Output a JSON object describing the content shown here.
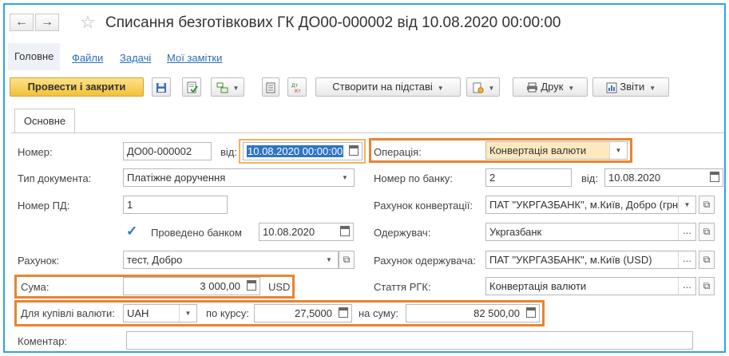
{
  "window": {
    "title": "Списання безготівкових ГК ДО00-000002 від 10.08.2020 00:00:00",
    "back_glyph": "←",
    "forward_glyph": "→",
    "star_glyph": "☆"
  },
  "nav": {
    "tabs": [
      {
        "label": "Головне"
      },
      {
        "label": "Файли"
      },
      {
        "label": "Задачі"
      },
      {
        "label": "Мої замітки"
      }
    ]
  },
  "toolbar": {
    "post_close_label": "Провести і закрити",
    "create_based_label": "Створити на підставі",
    "print_label": "Друк",
    "reports_label": "Звіти"
  },
  "form": {
    "tab_label": "Основне",
    "number": {
      "label": "Номер:",
      "value": "ДО00-000002"
    },
    "date": {
      "label": "від:",
      "value": "10.08.2020 00:00:00"
    },
    "doc_type": {
      "label": "Тип документа:",
      "value": "Платіжне доручення"
    },
    "pd_number": {
      "label": "Номер ПД:",
      "value": "1"
    },
    "bank_posted": {
      "label": "Проведено банком",
      "date": "10.08.2020",
      "checked": true
    },
    "account": {
      "label": "Рахунок:",
      "value": "тест, Добро"
    },
    "amount": {
      "label": "Сума:",
      "value": "3 000,00",
      "currency": "USD"
    },
    "buy_currency": {
      "label": "Для купівлі валюти:",
      "value": "UAH"
    },
    "rate": {
      "label": "по курсу:",
      "value": "27,5000"
    },
    "total": {
      "label": "на суму:",
      "value": "82 500,00"
    },
    "comment": {
      "label": "Коментар:",
      "value": ""
    },
    "operation": {
      "label": "Операція:",
      "value": "Конвертація валюти"
    },
    "bank_number": {
      "label": "Номер по банку:",
      "value": "2"
    },
    "bank_date": {
      "label": "від:",
      "value": "10.08.2020"
    },
    "conversion_account": {
      "label": "Рахунок конвертації:",
      "value": "ПАТ \"УКРГАЗБАНК\", м.Київ, Добро (грн)"
    },
    "recipient": {
      "label": "Одержувач:",
      "value": "Укргазбанк"
    },
    "recipient_account": {
      "label": "Рахунок одержувача:",
      "value": "ПАТ \"УКРГАЗБАНК\", м.Київ (USD)"
    },
    "rgk_article": {
      "label": "Стаття РГК:",
      "value": "Конвертація валюти"
    }
  },
  "colors": {
    "highlight_border": "#e8842f",
    "window_border": "#2aa7e0",
    "primary_button": "#f2c13a",
    "selection": "#2f74c9"
  }
}
